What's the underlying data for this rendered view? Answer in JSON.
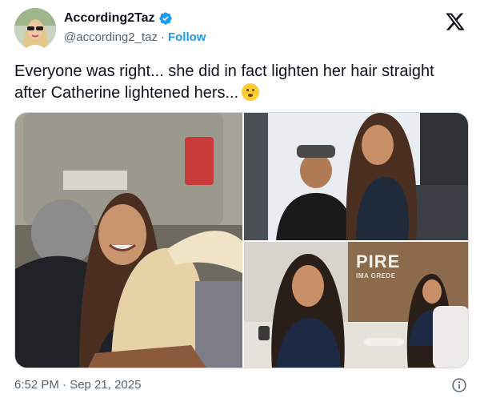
{
  "tweet": {
    "display_name": "According2Taz",
    "handle": "@according2_taz",
    "separator": "·",
    "follow_label": "Follow",
    "text": "Everyone was right... she did in fact lighten her hair straight after Catherine lightened hers...",
    "emoji": "thinking-face-emoji",
    "timestamp": "6:52 PM · Sep 21, 2025",
    "verified": true
  },
  "media": {
    "overlay_title": "PIRE",
    "overlay_subtitle": "IMA GREDE"
  },
  "colors": {
    "link": "#1d9bf0",
    "secondary_text": "#536471",
    "primary_text": "#0f1419",
    "border": "#cfd9de"
  },
  "icons": [
    "verified-badge-icon",
    "x-logo-icon",
    "info-icon"
  ]
}
